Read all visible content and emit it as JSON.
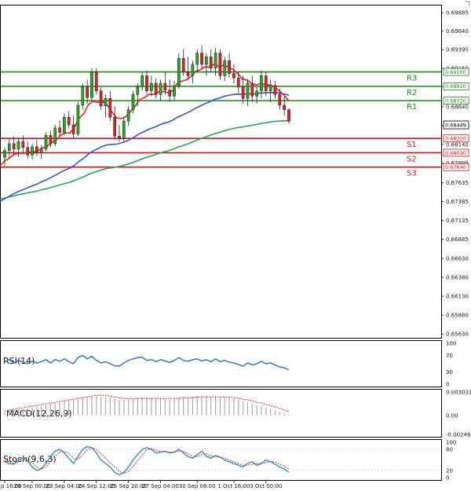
{
  "chart_data": {
    "type": "candlestick",
    "price_panel": {
      "y_ticks": [
        "0.69885",
        "0.69640",
        "0.69395",
        "0.69150",
        "0.68905",
        "0.68640",
        "0.68390",
        "0.68140",
        "0.67895",
        "0.67635",
        "0.67385",
        "0.67135",
        "0.66885",
        "0.66630",
        "0.66380",
        "0.66130",
        "0.65880",
        "0.65630"
      ],
      "ylim": [
        0.6558,
        0.6998
      ],
      "current_price": "0.68449",
      "resistance": [
        {
          "name": "R3",
          "value": 0.691,
          "label": "0.69100"
        },
        {
          "name": "R2",
          "value": 0.6891,
          "label": "0.68910"
        },
        {
          "name": "R1",
          "value": 0.6872,
          "label": "0.68720"
        }
      ],
      "support": [
        {
          "name": "S1",
          "value": 0.6822,
          "label": "0.68220"
        },
        {
          "name": "S2",
          "value": 0.6803,
          "label": "0.68030"
        },
        {
          "name": "S3",
          "value": 0.6784,
          "label": "0.67840"
        }
      ],
      "colors": {
        "bull": "#22aa22",
        "bear": "#dd2222",
        "resistance": "#1a8a1a",
        "support": "#dd1111",
        "ma_fast": "#ee2222",
        "ma_mid": "#3355dd",
        "ma_slow": "#22aa55"
      },
      "candles": [
        {
          "o": 0.6797,
          "h": 0.681,
          "l": 0.6785,
          "c": 0.6806
        },
        {
          "o": 0.6806,
          "h": 0.6821,
          "l": 0.6796,
          "c": 0.6815
        },
        {
          "o": 0.6815,
          "h": 0.6825,
          "l": 0.68,
          "c": 0.6808
        },
        {
          "o": 0.6808,
          "h": 0.6822,
          "l": 0.6798,
          "c": 0.6818
        },
        {
          "o": 0.6818,
          "h": 0.6826,
          "l": 0.6804,
          "c": 0.681
        },
        {
          "o": 0.681,
          "h": 0.6818,
          "l": 0.6795,
          "c": 0.68
        },
        {
          "o": 0.68,
          "h": 0.6815,
          "l": 0.6794,
          "c": 0.6811
        },
        {
          "o": 0.6811,
          "h": 0.682,
          "l": 0.6799,
          "c": 0.6803
        },
        {
          "o": 0.6803,
          "h": 0.6813,
          "l": 0.6795,
          "c": 0.6808
        },
        {
          "o": 0.6808,
          "h": 0.683,
          "l": 0.6805,
          "c": 0.6826
        },
        {
          "o": 0.6826,
          "h": 0.6832,
          "l": 0.681,
          "c": 0.6815
        },
        {
          "o": 0.6815,
          "h": 0.684,
          "l": 0.6812,
          "c": 0.6836
        },
        {
          "o": 0.6836,
          "h": 0.6846,
          "l": 0.6825,
          "c": 0.683
        },
        {
          "o": 0.683,
          "h": 0.6855,
          "l": 0.6826,
          "c": 0.685
        },
        {
          "o": 0.685,
          "h": 0.6858,
          "l": 0.6835,
          "c": 0.684
        },
        {
          "o": 0.684,
          "h": 0.6852,
          "l": 0.6822,
          "c": 0.6828
        },
        {
          "o": 0.6828,
          "h": 0.687,
          "l": 0.6825,
          "c": 0.6866
        },
        {
          "o": 0.6866,
          "h": 0.6895,
          "l": 0.686,
          "c": 0.689
        },
        {
          "o": 0.689,
          "h": 0.69,
          "l": 0.6868,
          "c": 0.6876
        },
        {
          "o": 0.6876,
          "h": 0.6915,
          "l": 0.6872,
          "c": 0.691
        },
        {
          "o": 0.691,
          "h": 0.6915,
          "l": 0.688,
          "c": 0.6885
        },
        {
          "o": 0.6885,
          "h": 0.689,
          "l": 0.686,
          "c": 0.6865
        },
        {
          "o": 0.6865,
          "h": 0.688,
          "l": 0.685,
          "c": 0.6875
        },
        {
          "o": 0.6875,
          "h": 0.6885,
          "l": 0.6845,
          "c": 0.685
        },
        {
          "o": 0.685,
          "h": 0.6865,
          "l": 0.682,
          "c": 0.6825
        },
        {
          "o": 0.6825,
          "h": 0.684,
          "l": 0.6818,
          "c": 0.6822
        },
        {
          "o": 0.6822,
          "h": 0.685,
          "l": 0.6818,
          "c": 0.6845
        },
        {
          "o": 0.6845,
          "h": 0.6865,
          "l": 0.6838,
          "c": 0.686
        },
        {
          "o": 0.686,
          "h": 0.6885,
          "l": 0.6855,
          "c": 0.688
        },
        {
          "o": 0.688,
          "h": 0.6895,
          "l": 0.6865,
          "c": 0.689
        },
        {
          "o": 0.689,
          "h": 0.691,
          "l": 0.6885,
          "c": 0.6905
        },
        {
          "o": 0.6905,
          "h": 0.6912,
          "l": 0.688,
          "c": 0.6885
        },
        {
          "o": 0.6885,
          "h": 0.6905,
          "l": 0.6878,
          "c": 0.6895
        },
        {
          "o": 0.6895,
          "h": 0.6902,
          "l": 0.6875,
          "c": 0.688
        },
        {
          "o": 0.688,
          "h": 0.69,
          "l": 0.6872,
          "c": 0.6895
        },
        {
          "o": 0.6895,
          "h": 0.691,
          "l": 0.688,
          "c": 0.6886
        },
        {
          "o": 0.6886,
          "h": 0.69,
          "l": 0.687,
          "c": 0.6878
        },
        {
          "o": 0.6878,
          "h": 0.6898,
          "l": 0.6872,
          "c": 0.6892
        },
        {
          "o": 0.6892,
          "h": 0.6935,
          "l": 0.6888,
          "c": 0.6928
        },
        {
          "o": 0.6928,
          "h": 0.694,
          "l": 0.6905,
          "c": 0.691
        },
        {
          "o": 0.691,
          "h": 0.693,
          "l": 0.69,
          "c": 0.6905
        },
        {
          "o": 0.6905,
          "h": 0.6925,
          "l": 0.6895,
          "c": 0.692
        },
        {
          "o": 0.692,
          "h": 0.694,
          "l": 0.691,
          "c": 0.6935
        },
        {
          "o": 0.6935,
          "h": 0.6945,
          "l": 0.6915,
          "c": 0.692
        },
        {
          "o": 0.692,
          "h": 0.6935,
          "l": 0.6905,
          "c": 0.693
        },
        {
          "o": 0.693,
          "h": 0.694,
          "l": 0.691,
          "c": 0.6915
        },
        {
          "o": 0.6915,
          "h": 0.6942,
          "l": 0.6905,
          "c": 0.6935
        },
        {
          "o": 0.6935,
          "h": 0.694,
          "l": 0.69,
          "c": 0.6905
        },
        {
          "o": 0.6905,
          "h": 0.693,
          "l": 0.6898,
          "c": 0.6925
        },
        {
          "o": 0.6925,
          "h": 0.6935,
          "l": 0.6902,
          "c": 0.6908
        },
        {
          "o": 0.6908,
          "h": 0.692,
          "l": 0.6895,
          "c": 0.6902
        },
        {
          "o": 0.6902,
          "h": 0.691,
          "l": 0.6882,
          "c": 0.689
        },
        {
          "o": 0.689,
          "h": 0.6905,
          "l": 0.6868,
          "c": 0.6875
        },
        {
          "o": 0.6875,
          "h": 0.69,
          "l": 0.6865,
          "c": 0.6895
        },
        {
          "o": 0.6895,
          "h": 0.6905,
          "l": 0.687,
          "c": 0.6878
        },
        {
          "o": 0.6878,
          "h": 0.689,
          "l": 0.6868,
          "c": 0.6885
        },
        {
          "o": 0.6885,
          "h": 0.6912,
          "l": 0.6875,
          "c": 0.6905
        },
        {
          "o": 0.6905,
          "h": 0.691,
          "l": 0.6878,
          "c": 0.6885
        },
        {
          "o": 0.6885,
          "h": 0.69,
          "l": 0.687,
          "c": 0.6892
        },
        {
          "o": 0.6892,
          "h": 0.6898,
          "l": 0.6875,
          "c": 0.688
        },
        {
          "o": 0.688,
          "h": 0.6888,
          "l": 0.686,
          "c": 0.6866
        },
        {
          "o": 0.6866,
          "h": 0.6878,
          "l": 0.6852,
          "c": 0.686
        },
        {
          "o": 0.686,
          "h": 0.6862,
          "l": 0.6842,
          "c": 0.6845
        }
      ]
    },
    "x_ticks": [
      {
        "label": "p 16:00",
        "at": 0
      },
      {
        "label": "20 Sep 00:00",
        "at": 6
      },
      {
        "label": "23 Sep 04:00",
        "at": 13
      },
      {
        "label": "24 Sep 12:00",
        "at": 20
      },
      {
        "label": "25 Sep 20:00",
        "at": 27
      },
      {
        "label": "27 Sep 04:00",
        "at": 34
      },
      {
        "label": "30 Sep 08:00",
        "at": 42
      },
      {
        "label": "1 Oct 16:00",
        "at": 50
      },
      {
        "label": "3 Oct 00:00",
        "at": 57
      }
    ],
    "rsi": {
      "label": "RSI(14)",
      "ticks": [
        "100",
        "70",
        "30",
        "0"
      ],
      "ylim": [
        0,
        100
      ],
      "values": [
        55,
        60,
        52,
        58,
        54,
        50,
        56,
        52,
        55,
        60,
        52,
        60,
        56,
        62,
        55,
        50,
        65,
        70,
        62,
        68,
        58,
        52,
        55,
        50,
        45,
        44,
        52,
        58,
        62,
        65,
        66,
        58,
        60,
        55,
        60,
        57,
        53,
        58,
        65,
        58,
        56,
        60,
        62,
        57,
        60,
        55,
        62,
        55,
        58,
        54,
        52,
        48,
        44,
        52,
        47,
        50,
        56,
        50,
        52,
        47,
        42,
        40,
        35
      ]
    },
    "macd": {
      "label": "MACD(12,26,9)",
      "ticks": [
        "0.003031",
        "0.00",
        "-0.002465"
      ],
      "ylim": [
        -0.002465,
        0.003031
      ],
      "hist": [
        0.0005,
        0.0006,
        0.0007,
        0.0008,
        0.0009,
        0.0009,
        0.001,
        0.0011,
        0.0012,
        0.0014,
        0.0015,
        0.0016,
        0.0017,
        0.0019,
        0.002,
        0.002,
        0.0021,
        0.0023,
        0.0024,
        0.0025,
        0.0025,
        0.0024,
        0.0024,
        0.0023,
        0.0022,
        0.002,
        0.002,
        0.0021,
        0.0022,
        0.0023,
        0.0024,
        0.0023,
        0.0023,
        0.0022,
        0.0022,
        0.0021,
        0.002,
        0.0021,
        0.0023,
        0.0024,
        0.0024,
        0.0024,
        0.0025,
        0.0025,
        0.0025,
        0.0024,
        0.0025,
        0.0024,
        0.0024,
        0.0023,
        0.0022,
        0.002,
        0.0018,
        0.0017,
        0.0015,
        0.0013,
        0.0012,
        0.001,
        0.0009,
        0.0007,
        0.0005,
        0.0003,
        0.0001
      ],
      "signal": [
        0.0006,
        0.0007,
        0.0008,
        0.0009,
        0.001,
        0.0011,
        0.0012,
        0.0013,
        0.0014,
        0.0015,
        0.0016,
        0.0017,
        0.0018,
        0.0019,
        0.002,
        0.0021,
        0.0022,
        0.0023,
        0.0024,
        0.0025,
        0.0026,
        0.0026,
        0.0026,
        0.0025,
        0.0024,
        0.0023,
        0.0022,
        0.0022,
        0.0022,
        0.0022,
        0.0022,
        0.0022,
        0.0022,
        0.0022,
        0.0022,
        0.0022,
        0.0022,
        0.0022,
        0.0022,
        0.0023,
        0.0023,
        0.0023,
        0.0024,
        0.0024,
        0.0024,
        0.0024,
        0.0024,
        0.0024,
        0.0024,
        0.0024,
        0.0023,
        0.0022,
        0.0021,
        0.002,
        0.0019,
        0.0017,
        0.0016,
        0.0014,
        0.0013,
        0.0011,
        0.0009,
        0.0007,
        0.0005
      ]
    },
    "stoch": {
      "label": "Stoch(9,6,3)",
      "ticks": [
        "100",
        "80",
        "20",
        "0"
      ],
      "ylim": [
        0,
        100
      ],
      "k": [
        45,
        40,
        38,
        50,
        55,
        48,
        30,
        20,
        25,
        40,
        60,
        75,
        80,
        70,
        55,
        40,
        60,
        80,
        88,
        85,
        70,
        50,
        40,
        30,
        15,
        8,
        15,
        30,
        50,
        65,
        80,
        85,
        80,
        70,
        72,
        75,
        70,
        72,
        80,
        70,
        60,
        55,
        65,
        75,
        60,
        55,
        62,
        58,
        50,
        45,
        40,
        35,
        30,
        40,
        45,
        35,
        40,
        50,
        45,
        38,
        30,
        25,
        15
      ],
      "d": [
        50,
        45,
        40,
        45,
        50,
        50,
        42,
        30,
        25,
        30,
        45,
        60,
        72,
        75,
        68,
        55,
        52,
        65,
        78,
        85,
        80,
        68,
        55,
        42,
        30,
        18,
        12,
        18,
        32,
        48,
        65,
        78,
        82,
        78,
        74,
        73,
        72,
        72,
        75,
        74,
        68,
        60,
        60,
        65,
        68,
        62,
        60,
        58,
        55,
        50,
        45,
        40,
        35,
        35,
        38,
        40,
        40,
        42,
        46,
        44,
        38,
        32,
        24
      ]
    }
  }
}
